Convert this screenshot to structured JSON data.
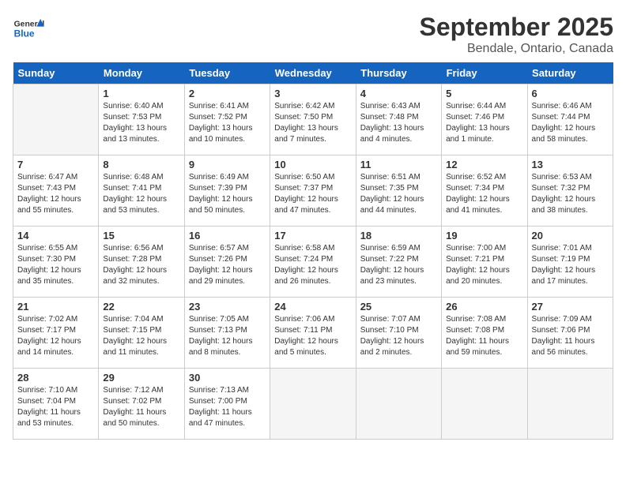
{
  "header": {
    "logo_line1": "General",
    "logo_line2": "Blue",
    "title": "September 2025",
    "subtitle": "Bendale, Ontario, Canada"
  },
  "weekdays": [
    "Sunday",
    "Monday",
    "Tuesday",
    "Wednesday",
    "Thursday",
    "Friday",
    "Saturday"
  ],
  "weeks": [
    [
      {
        "day": "",
        "empty": true
      },
      {
        "day": "1",
        "sunrise": "Sunrise: 6:40 AM",
        "sunset": "Sunset: 7:53 PM",
        "daylight": "Daylight: 13 hours and 13 minutes."
      },
      {
        "day": "2",
        "sunrise": "Sunrise: 6:41 AM",
        "sunset": "Sunset: 7:52 PM",
        "daylight": "Daylight: 13 hours and 10 minutes."
      },
      {
        "day": "3",
        "sunrise": "Sunrise: 6:42 AM",
        "sunset": "Sunset: 7:50 PM",
        "daylight": "Daylight: 13 hours and 7 minutes."
      },
      {
        "day": "4",
        "sunrise": "Sunrise: 6:43 AM",
        "sunset": "Sunset: 7:48 PM",
        "daylight": "Daylight: 13 hours and 4 minutes."
      },
      {
        "day": "5",
        "sunrise": "Sunrise: 6:44 AM",
        "sunset": "Sunset: 7:46 PM",
        "daylight": "Daylight: 13 hours and 1 minute."
      },
      {
        "day": "6",
        "sunrise": "Sunrise: 6:46 AM",
        "sunset": "Sunset: 7:44 PM",
        "daylight": "Daylight: 12 hours and 58 minutes."
      }
    ],
    [
      {
        "day": "7",
        "sunrise": "Sunrise: 6:47 AM",
        "sunset": "Sunset: 7:43 PM",
        "daylight": "Daylight: 12 hours and 55 minutes."
      },
      {
        "day": "8",
        "sunrise": "Sunrise: 6:48 AM",
        "sunset": "Sunset: 7:41 PM",
        "daylight": "Daylight: 12 hours and 53 minutes."
      },
      {
        "day": "9",
        "sunrise": "Sunrise: 6:49 AM",
        "sunset": "Sunset: 7:39 PM",
        "daylight": "Daylight: 12 hours and 50 minutes."
      },
      {
        "day": "10",
        "sunrise": "Sunrise: 6:50 AM",
        "sunset": "Sunset: 7:37 PM",
        "daylight": "Daylight: 12 hours and 47 minutes."
      },
      {
        "day": "11",
        "sunrise": "Sunrise: 6:51 AM",
        "sunset": "Sunset: 7:35 PM",
        "daylight": "Daylight: 12 hours and 44 minutes."
      },
      {
        "day": "12",
        "sunrise": "Sunrise: 6:52 AM",
        "sunset": "Sunset: 7:34 PM",
        "daylight": "Daylight: 12 hours and 41 minutes."
      },
      {
        "day": "13",
        "sunrise": "Sunrise: 6:53 AM",
        "sunset": "Sunset: 7:32 PM",
        "daylight": "Daylight: 12 hours and 38 minutes."
      }
    ],
    [
      {
        "day": "14",
        "sunrise": "Sunrise: 6:55 AM",
        "sunset": "Sunset: 7:30 PM",
        "daylight": "Daylight: 12 hours and 35 minutes."
      },
      {
        "day": "15",
        "sunrise": "Sunrise: 6:56 AM",
        "sunset": "Sunset: 7:28 PM",
        "daylight": "Daylight: 12 hours and 32 minutes."
      },
      {
        "day": "16",
        "sunrise": "Sunrise: 6:57 AM",
        "sunset": "Sunset: 7:26 PM",
        "daylight": "Daylight: 12 hours and 29 minutes."
      },
      {
        "day": "17",
        "sunrise": "Sunrise: 6:58 AM",
        "sunset": "Sunset: 7:24 PM",
        "daylight": "Daylight: 12 hours and 26 minutes."
      },
      {
        "day": "18",
        "sunrise": "Sunrise: 6:59 AM",
        "sunset": "Sunset: 7:22 PM",
        "daylight": "Daylight: 12 hours and 23 minutes."
      },
      {
        "day": "19",
        "sunrise": "Sunrise: 7:00 AM",
        "sunset": "Sunset: 7:21 PM",
        "daylight": "Daylight: 12 hours and 20 minutes."
      },
      {
        "day": "20",
        "sunrise": "Sunrise: 7:01 AM",
        "sunset": "Sunset: 7:19 PM",
        "daylight": "Daylight: 12 hours and 17 minutes."
      }
    ],
    [
      {
        "day": "21",
        "sunrise": "Sunrise: 7:02 AM",
        "sunset": "Sunset: 7:17 PM",
        "daylight": "Daylight: 12 hours and 14 minutes."
      },
      {
        "day": "22",
        "sunrise": "Sunrise: 7:04 AM",
        "sunset": "Sunset: 7:15 PM",
        "daylight": "Daylight: 12 hours and 11 minutes."
      },
      {
        "day": "23",
        "sunrise": "Sunrise: 7:05 AM",
        "sunset": "Sunset: 7:13 PM",
        "daylight": "Daylight: 12 hours and 8 minutes."
      },
      {
        "day": "24",
        "sunrise": "Sunrise: 7:06 AM",
        "sunset": "Sunset: 7:11 PM",
        "daylight": "Daylight: 12 hours and 5 minutes."
      },
      {
        "day": "25",
        "sunrise": "Sunrise: 7:07 AM",
        "sunset": "Sunset: 7:10 PM",
        "daylight": "Daylight: 12 hours and 2 minutes."
      },
      {
        "day": "26",
        "sunrise": "Sunrise: 7:08 AM",
        "sunset": "Sunset: 7:08 PM",
        "daylight": "Daylight: 11 hours and 59 minutes."
      },
      {
        "day": "27",
        "sunrise": "Sunrise: 7:09 AM",
        "sunset": "Sunset: 7:06 PM",
        "daylight": "Daylight: 11 hours and 56 minutes."
      }
    ],
    [
      {
        "day": "28",
        "sunrise": "Sunrise: 7:10 AM",
        "sunset": "Sunset: 7:04 PM",
        "daylight": "Daylight: 11 hours and 53 minutes."
      },
      {
        "day": "29",
        "sunrise": "Sunrise: 7:12 AM",
        "sunset": "Sunset: 7:02 PM",
        "daylight": "Daylight: 11 hours and 50 minutes."
      },
      {
        "day": "30",
        "sunrise": "Sunrise: 7:13 AM",
        "sunset": "Sunset: 7:00 PM",
        "daylight": "Daylight: 11 hours and 47 minutes."
      },
      {
        "day": "",
        "empty": true
      },
      {
        "day": "",
        "empty": true
      },
      {
        "day": "",
        "empty": true
      },
      {
        "day": "",
        "empty": true
      }
    ]
  ]
}
